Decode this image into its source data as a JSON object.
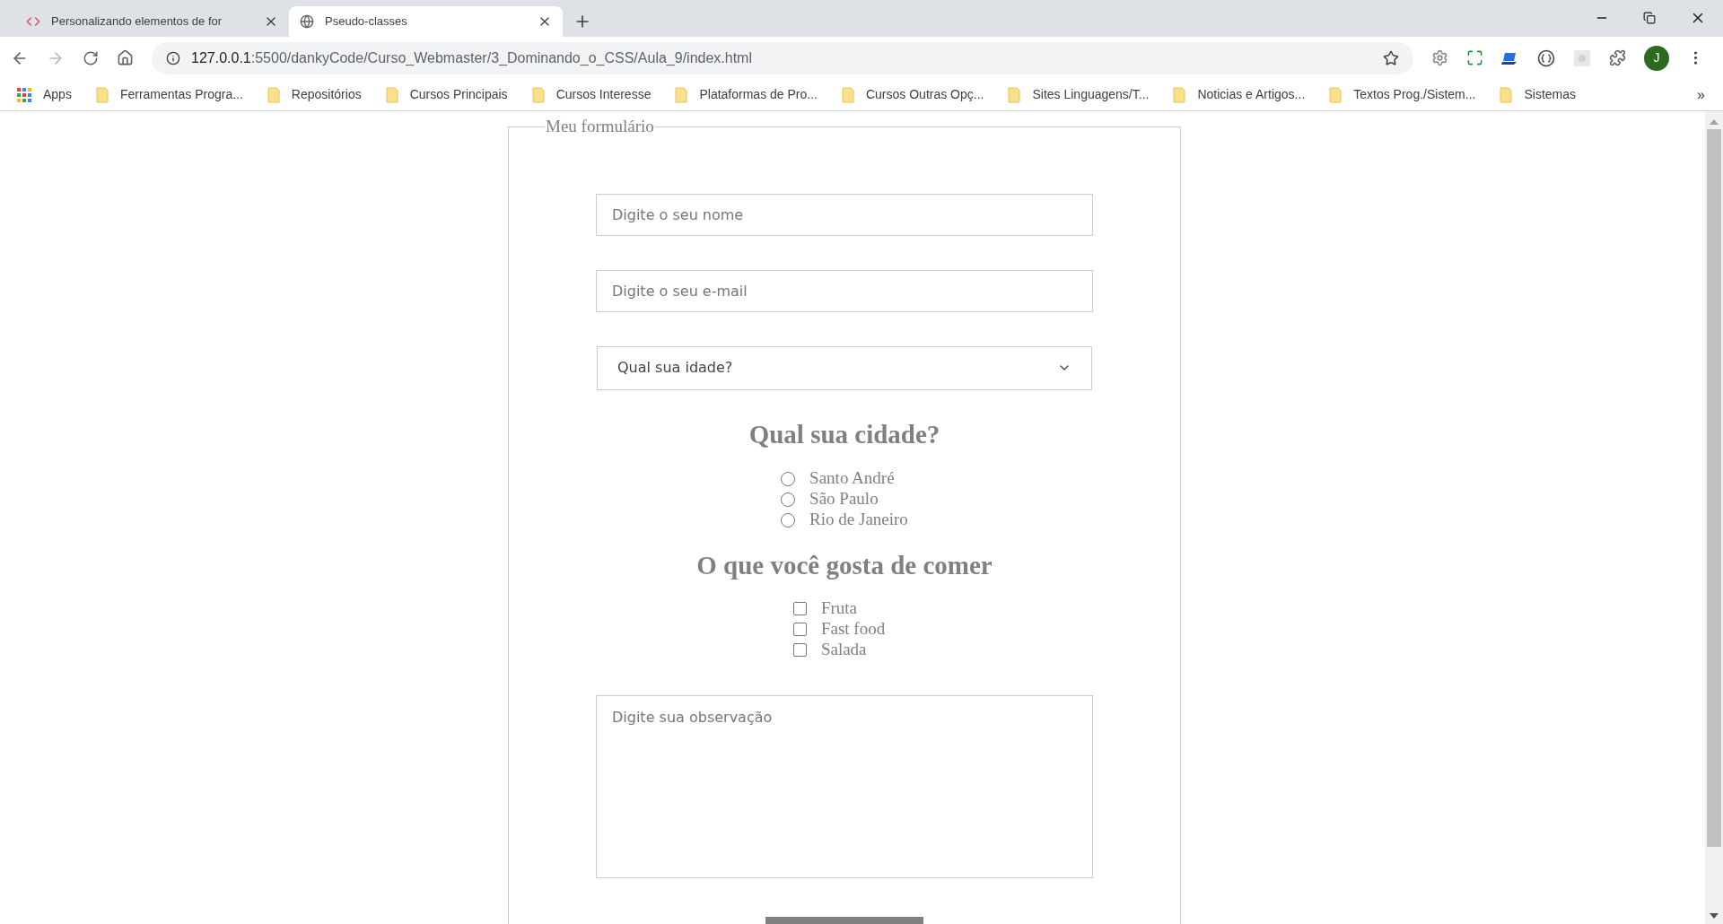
{
  "tabs": [
    {
      "title": "Personalizando elementos de for",
      "kind": "code",
      "selected": false
    },
    {
      "title": "Pseudo-classes",
      "kind": "globe",
      "selected": true
    }
  ],
  "address_bar": {
    "host": "127.0.0.1",
    "path": ":5500/dankyCode/Curso_Webmaster/3_Dominando_o_CSS/Aula_9/index.html"
  },
  "profile_initial": "J",
  "bookmarks": [
    {
      "label": "Apps",
      "kind": "apps"
    },
    {
      "label": "Ferramentas Progra...",
      "kind": "folder"
    },
    {
      "label": "Repositórios",
      "kind": "folder"
    },
    {
      "label": "Cursos Principais",
      "kind": "folder"
    },
    {
      "label": "Cursos Interesse",
      "kind": "folder"
    },
    {
      "label": "Plataformas de Pro...",
      "kind": "folder"
    },
    {
      "label": "Cursos Outras Opç...",
      "kind": "folder"
    },
    {
      "label": "Sites Linguagens/T...",
      "kind": "folder"
    },
    {
      "label": "Noticias e Artigos...",
      "kind": "folder"
    },
    {
      "label": "Textos Prog./Sistem...",
      "kind": "folder"
    },
    {
      "label": "Sistemas",
      "kind": "folder"
    }
  ],
  "bookmarks_more": "»",
  "form": {
    "legend": "Meu formulário",
    "name_field": {
      "placeholder": "Digite o seu nome"
    },
    "email_field": {
      "placeholder": "Digite o seu e-mail"
    },
    "age_select": {
      "value": "Qual sua idade?"
    },
    "city_heading": "Qual sua cidade?",
    "cities": [
      {
        "label": "Santo André",
        "selected": false
      },
      {
        "label": "São Paulo",
        "selected": false
      },
      {
        "label": "Rio de Janeiro",
        "selected": false
      }
    ],
    "food_heading": "O que você gosta de comer",
    "foods": [
      {
        "label": "Fruta",
        "checked": false
      },
      {
        "label": "Fast food",
        "checked": false
      },
      {
        "label": "Salada",
        "checked": false
      }
    ],
    "notes_field": {
      "placeholder": "Digite sua observação"
    }
  }
}
